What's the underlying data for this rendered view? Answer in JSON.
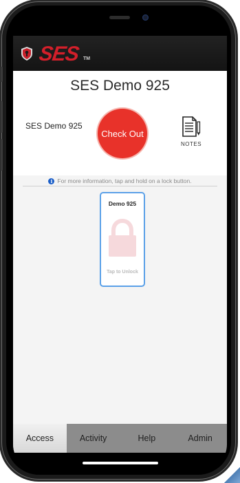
{
  "app": {
    "brand": "SES",
    "trademark": "TM"
  },
  "page": {
    "title": "SES Demo 925",
    "location_label": "SES Demo 925",
    "checkout_label": "Check Out",
    "notes_label": "NOTES",
    "info_text": "For more information, tap and hold on a lock button.",
    "info_icon": "info-icon"
  },
  "locks": [
    {
      "name": "Demo 925",
      "caption": "Tap to Unlock",
      "icon": "padlock-icon"
    }
  ],
  "tabs": [
    {
      "label": "Access",
      "active": true
    },
    {
      "label": "Activity",
      "active": false
    },
    {
      "label": "Help",
      "active": false
    },
    {
      "label": "Admin",
      "active": false
    }
  ],
  "colors": {
    "brand_red": "#d21f2a",
    "checkout_red": "#e8322a",
    "lock_border_blue": "#5aa0e8",
    "lock_fill_pink": "#f6d9dc",
    "info_blue": "#1a5ec8"
  }
}
